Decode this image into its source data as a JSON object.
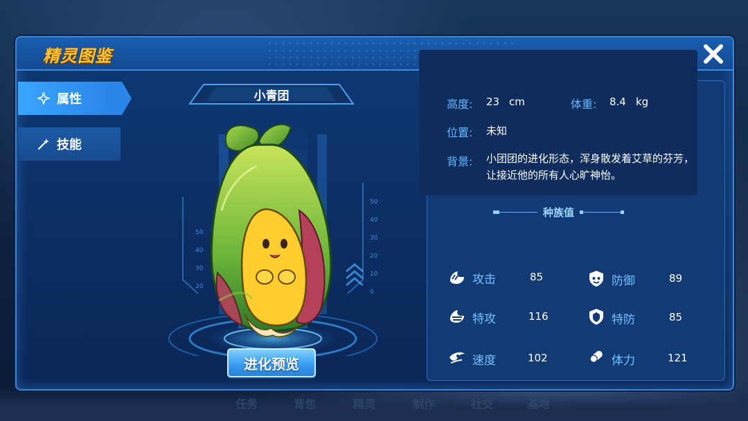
{
  "window": {
    "title": "精灵图鉴",
    "close_icon": "close-x-icon"
  },
  "tabs": [
    {
      "label": "属性",
      "icon": "sparkle-icon",
      "active": true
    },
    {
      "label": "技能",
      "icon": "magic-wand-icon",
      "active": false
    }
  ],
  "background_nav": [
    "任务",
    "背包",
    "精灵",
    "制作",
    "社交",
    "基地"
  ],
  "pokemon": {
    "name": "小青团",
    "evolve_button": "进化预览"
  },
  "stage_scale": {
    "left": [
      "50",
      "40",
      "30",
      "20"
    ],
    "right": [
      "50",
      "40",
      "30",
      "20",
      "10",
      "0"
    ]
  },
  "info": {
    "height_label": "高度:",
    "height_value": "23",
    "height_unit": "cm",
    "weight_label": "体重:",
    "weight_value": "8.4",
    "weight_unit": "kg",
    "location_label": "位置:",
    "location_value": "未知",
    "background_label": "背景:",
    "background_value": "小团团的进化形态，浑身散发着艾草的芬芳，让接近他的所有人心旷神怡。"
  },
  "stats": {
    "title": "种族值",
    "items": [
      {
        "label": "攻击",
        "value": "85",
        "icon": "attack-icon"
      },
      {
        "label": "防御",
        "value": "89",
        "icon": "defense-icon"
      },
      {
        "label": "特攻",
        "value": "116",
        "icon": "special-attack-icon"
      },
      {
        "label": "特防",
        "value": "85",
        "icon": "special-defense-icon"
      },
      {
        "label": "速度",
        "value": "102",
        "icon": "speed-icon"
      },
      {
        "label": "体力",
        "value": "121",
        "icon": "hp-icon"
      }
    ]
  },
  "colors": {
    "accent": "#3aa5ff",
    "title": "#ffc630",
    "label": "#67b6ff"
  }
}
